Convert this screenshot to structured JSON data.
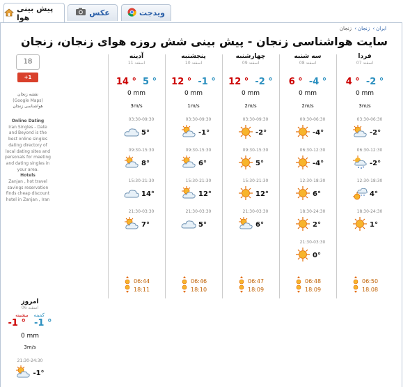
{
  "tabs": [
    {
      "label": "پیش بینی هوا",
      "icon": "home-icon",
      "active": true
    },
    {
      "label": "عکس",
      "icon": "camera-icon",
      "active": false
    },
    {
      "label": "ویدجت",
      "icon": "chrome-icon",
      "active": false
    }
  ],
  "breadcrumb": [
    "ایران",
    "زنجان",
    "زنجان"
  ],
  "page_title": "سایت هواشناسی زنجان - پیش بینی شش روزه هوای زنجان، زنجان",
  "sidebar": {
    "counter": "18",
    "gplus_label": "+1",
    "map_link": "نقشه زنجان",
    "map_sub": "(Google Maps)",
    "weather_link": "هواشناسی زنجان",
    "dating_title": "Online Dating",
    "dating_text": "Iran Singles - Date and Beyond is the best online singles dating directory of local dating sites and personals for meeting and dating singles in your area.",
    "hotels_title": "Hotels",
    "hotels_text": "Zanjan , hot travel savings reservation finds cheap discount hotel in Zanjan , Iran"
  },
  "days": [
    {
      "name": "فردا",
      "date": "07 اسفند",
      "min": "-2 °",
      "max": "4 °",
      "rain": "0 mm",
      "wind": "3m/s",
      "slots": [
        {
          "time": "03:30-06:30",
          "icon": "partly-cloudy-icon",
          "temp": "-2°"
        },
        {
          "time": "06:30-12:30",
          "icon": "cloud-snow-icon",
          "temp": "-2°"
        },
        {
          "time": "12:30-18:30",
          "icon": "sun-snow-icon",
          "temp": "4°"
        },
        {
          "time": "18:30-24:30",
          "icon": "sun-icon",
          "temp": "1°"
        }
      ],
      "sunrise": "06:50",
      "sunset": "18:08"
    },
    {
      "name": "سه شنبه",
      "date": "08 اسفند",
      "min": "-4 °",
      "max": "6 °",
      "rain": "0 mm",
      "wind": "2m/s",
      "slots": [
        {
          "time": "00:30-06:30",
          "icon": "sun-icon",
          "temp": "-4°"
        },
        {
          "time": "06:30-12:30",
          "icon": "sun-icon",
          "temp": "-4°"
        },
        {
          "time": "12:30-18:30",
          "icon": "sun-icon",
          "temp": "6°"
        },
        {
          "time": "18:30-24:30",
          "icon": "sun-icon",
          "temp": "2°"
        },
        {
          "time": "21:30-03:30",
          "icon": "sun-icon",
          "temp": "0°"
        }
      ],
      "sunrise": "06:48",
      "sunset": "18:09"
    },
    {
      "name": "چهارشنبه",
      "date": "09 اسفند",
      "min": "-2 °",
      "max": "12 °",
      "rain": "0 mm",
      "wind": "2m/s",
      "slots": [
        {
          "time": "03:30-09:30",
          "icon": "sun-icon",
          "temp": "-2°"
        },
        {
          "time": "09:30-15:30",
          "icon": "sun-icon",
          "temp": "5°"
        },
        {
          "time": "15:30-21:30",
          "icon": "sun-icon",
          "temp": "12°"
        },
        {
          "time": "21:30-03:30",
          "icon": "partly-cloudy-icon",
          "temp": "6°"
        }
      ],
      "sunrise": "06:47",
      "sunset": "18:09"
    },
    {
      "name": "پنجشنبه",
      "date": "10 اسفند",
      "min": "-1 °",
      "max": "12 °",
      "rain": "0 mm",
      "wind": "1m/s",
      "slots": [
        {
          "time": "03:30-09:30",
          "icon": "partly-cloudy-icon",
          "temp": "-1°"
        },
        {
          "time": "09:30-15:30",
          "icon": "partly-cloudy-icon",
          "temp": "6°"
        },
        {
          "time": "15:30-21:30",
          "icon": "partly-cloudy-icon",
          "temp": "12°"
        },
        {
          "time": "21:30-03:30",
          "icon": "cloud-icon",
          "temp": "5°"
        }
      ],
      "sunrise": "06:46",
      "sunset": "18:10"
    },
    {
      "name": "آدینه",
      "date": "11 اسفند",
      "min": "5 °",
      "max": "14 °",
      "rain": "0 mm",
      "wind": "3m/s",
      "slots": [
        {
          "time": "03:30-09:30",
          "icon": "cloud-icon",
          "temp": "5°"
        },
        {
          "time": "09:30-15:30",
          "icon": "partly-cloudy-icon",
          "temp": "8°"
        },
        {
          "time": "15:30-21:30",
          "icon": "cloud-icon",
          "temp": "14°"
        },
        {
          "time": "21:30-03:30",
          "icon": "partly-cloudy-icon",
          "temp": "7°"
        }
      ],
      "sunrise": "06:44",
      "sunset": "18:11"
    }
  ],
  "today": {
    "name": "امروز",
    "date": "06 اسفند",
    "min_label": "کمینه",
    "max_label": "بیشینه",
    "min": "-1 °",
    "max": "-1 °",
    "rain": "0 mm",
    "wind": "3m/s",
    "slot": {
      "time": "21:30-24:30",
      "icon": "partly-cloudy-icon",
      "temp": "-1°"
    }
  },
  "colors": {
    "min": "#2a8fbf",
    "max": "#cc0000",
    "link": "#2a5fa8"
  }
}
